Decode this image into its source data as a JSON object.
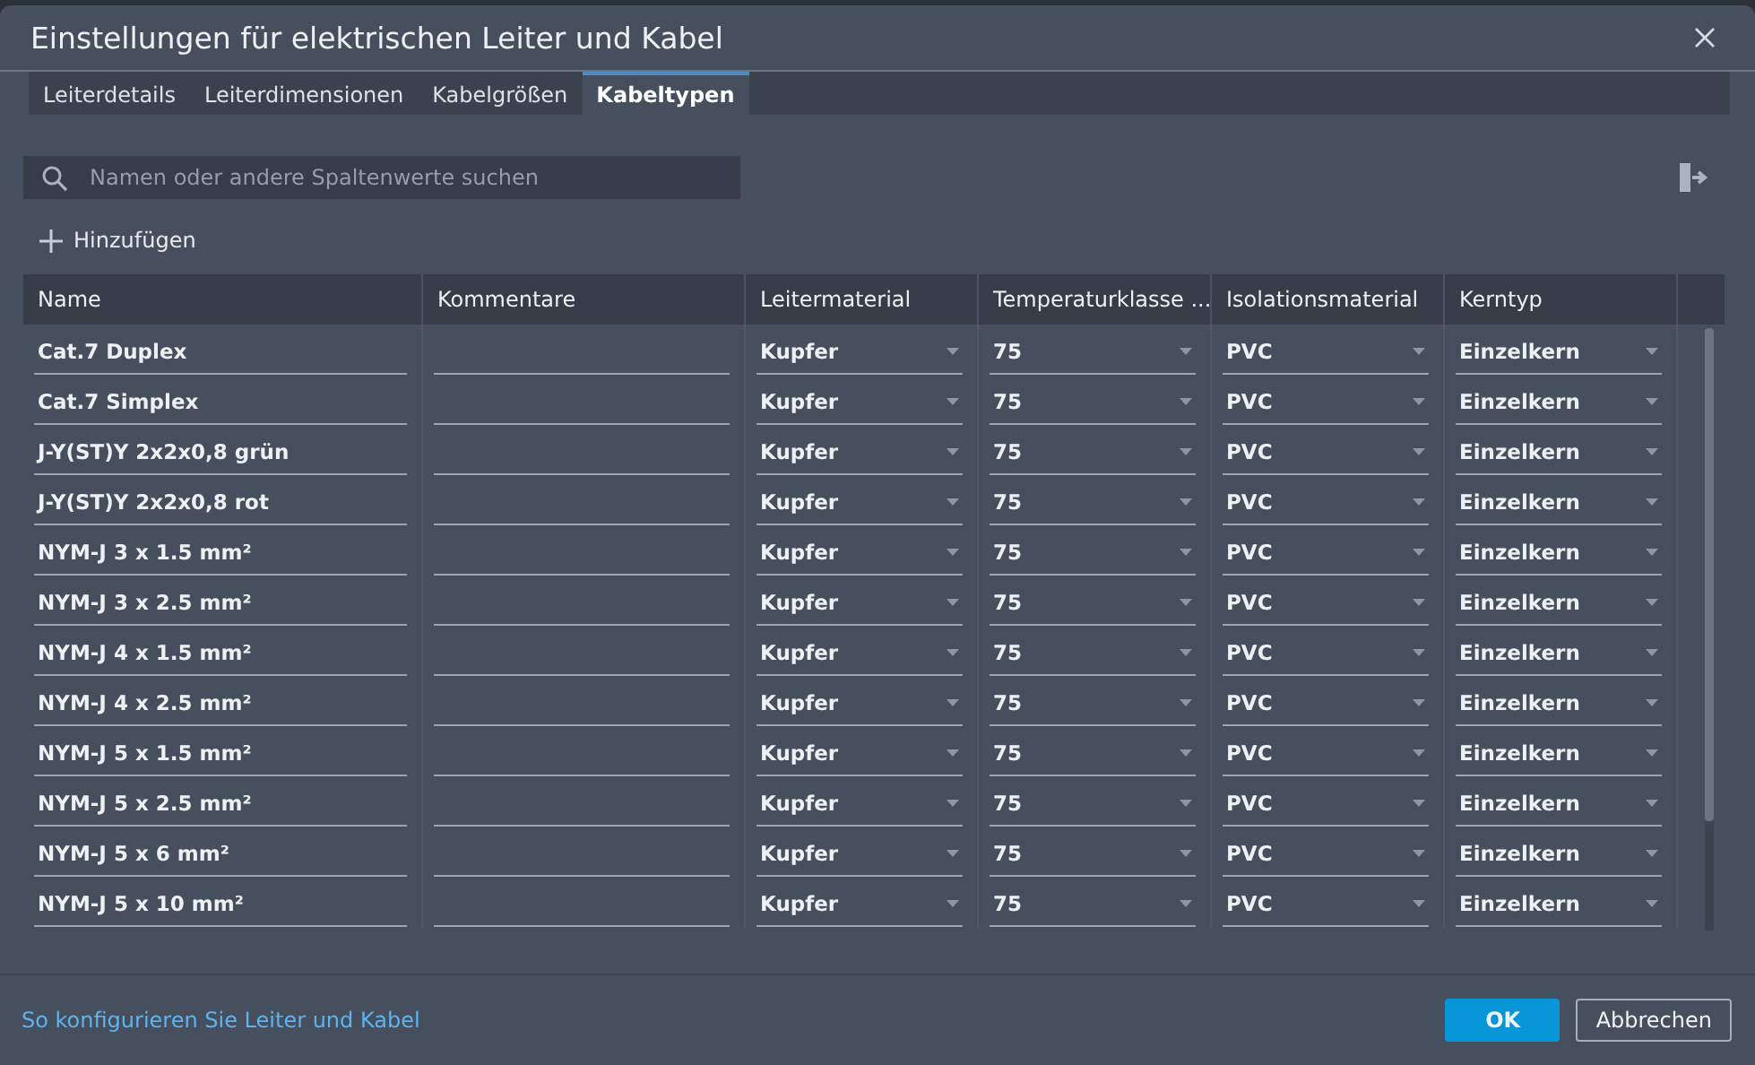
{
  "window": {
    "title": "Einstellungen für elektrischen Leiter und Kabel"
  },
  "tabs": [
    {
      "label": "Leiterdetails",
      "selected": false
    },
    {
      "label": "Leiterdimensionen",
      "selected": false
    },
    {
      "label": "Kabelgrößen",
      "selected": false
    },
    {
      "label": "Kabeltypen",
      "selected": true
    }
  ],
  "search": {
    "placeholder": "Namen oder andere Spaltenwerte suchen"
  },
  "add_button": {
    "label": "Hinzufügen"
  },
  "table": {
    "columns": [
      "Name",
      "Kommentare",
      "Leitermaterial",
      "Temperaturklasse ...",
      "Isolationsmaterial",
      "Kerntyp"
    ],
    "rows": [
      {
        "name": "Cat.7 Duplex",
        "material": "Kupfer",
        "temperature": "75",
        "insulation": "PVC",
        "core": "Einzelkern"
      },
      {
        "name": "Cat.7 Simplex",
        "material": "Kupfer",
        "temperature": "75",
        "insulation": "PVC",
        "core": "Einzelkern"
      },
      {
        "name": "J-Y(ST)Y 2x2x0,8 grün",
        "material": "Kupfer",
        "temperature": "75",
        "insulation": "PVC",
        "core": "Einzelkern"
      },
      {
        "name": "J-Y(ST)Y 2x2x0,8 rot",
        "material": "Kupfer",
        "temperature": "75",
        "insulation": "PVC",
        "core": "Einzelkern"
      },
      {
        "name": "NYM-J 3 x 1.5 mm²",
        "material": "Kupfer",
        "temperature": "75",
        "insulation": "PVC",
        "core": "Einzelkern"
      },
      {
        "name": "NYM-J 3 x 2.5 mm²",
        "material": "Kupfer",
        "temperature": "75",
        "insulation": "PVC",
        "core": "Einzelkern"
      },
      {
        "name": "NYM-J 4 x 1.5 mm²",
        "material": "Kupfer",
        "temperature": "75",
        "insulation": "PVC",
        "core": "Einzelkern"
      },
      {
        "name": "NYM-J 4 x 2.5 mm²",
        "material": "Kupfer",
        "temperature": "75",
        "insulation": "PVC",
        "core": "Einzelkern"
      },
      {
        "name": "NYM-J 5 x 1.5 mm²",
        "material": "Kupfer",
        "temperature": "75",
        "insulation": "PVC",
        "core": "Einzelkern"
      },
      {
        "name": "NYM-J 5 x 2.5 mm²",
        "material": "Kupfer",
        "temperature": "75",
        "insulation": "PVC",
        "core": "Einzelkern"
      },
      {
        "name": "NYM-J 5 x 6 mm²",
        "material": "Kupfer",
        "temperature": "75",
        "insulation": "PVC",
        "core": "Einzelkern"
      },
      {
        "name": "NYM-J 5 x 10 mm²",
        "material": "Kupfer",
        "temperature": "75",
        "insulation": "PVC",
        "core": "Einzelkern"
      }
    ]
  },
  "help_link": "So konfigurieren Sie Leiter und Kabel",
  "buttons": [
    {
      "kind": "primary",
      "label": "OK"
    },
    {
      "kind": "secondary",
      "label": "Abbrechen"
    }
  ]
}
